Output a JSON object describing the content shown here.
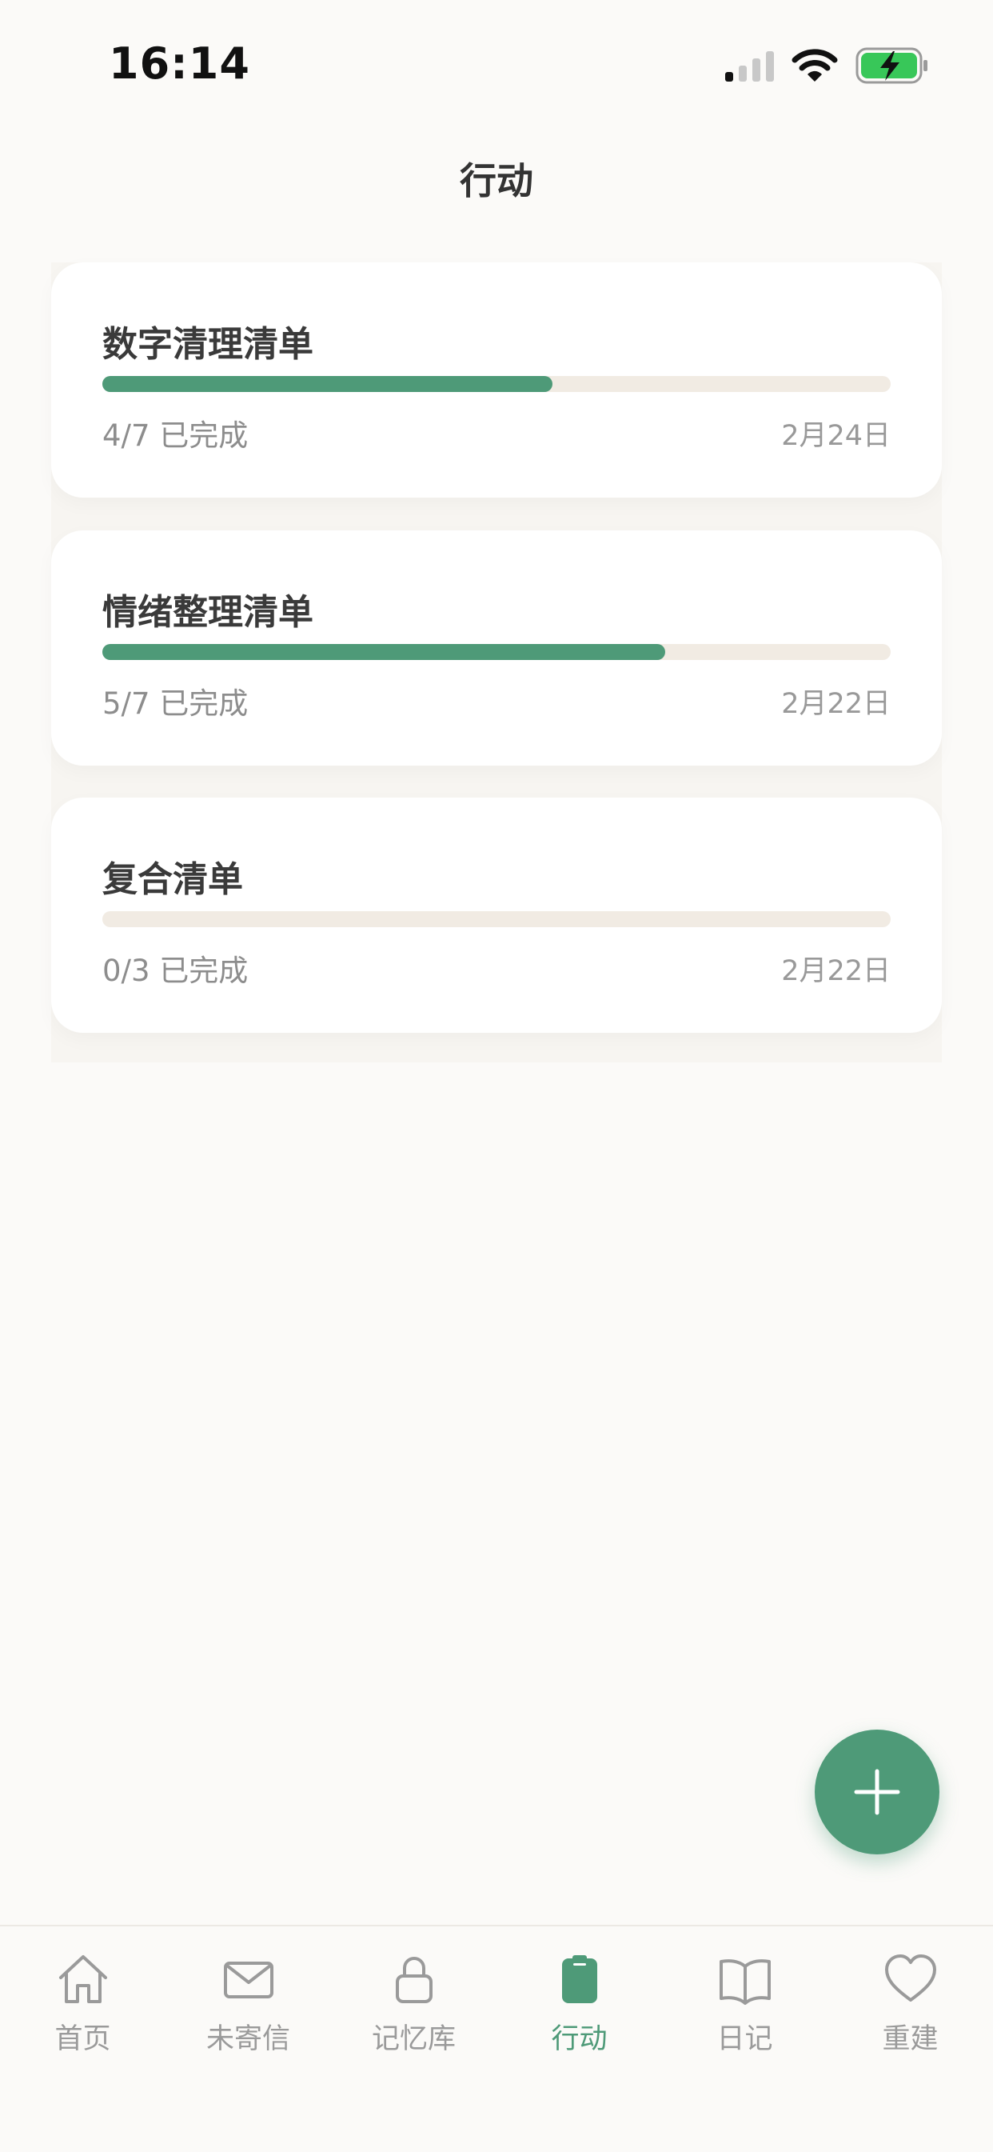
{
  "status_bar": {
    "time": "16:14"
  },
  "header": {
    "title": "行动"
  },
  "checklists": [
    {
      "title": "数字清理清单",
      "progress_text": "4/7 已完成",
      "date": "2月24日",
      "completed": 4,
      "total": 7
    },
    {
      "title": "情绪整理清单",
      "progress_text": "5/7 已完成",
      "date": "2月22日",
      "completed": 5,
      "total": 7
    },
    {
      "title": "复合清单",
      "progress_text": "0/3 已完成",
      "date": "2月22日",
      "completed": 0,
      "total": 3
    }
  ],
  "fab": {
    "icon": "plus-icon"
  },
  "tab_bar": {
    "tabs": [
      {
        "label": "首页",
        "icon": "home-icon"
      },
      {
        "label": "未寄信",
        "icon": "envelope-icon"
      },
      {
        "label": "记忆库",
        "icon": "lock-icon"
      },
      {
        "label": "行动",
        "icon": "clipboard-icon",
        "active": true
      },
      {
        "label": "日记",
        "icon": "book-icon"
      },
      {
        "label": "重建",
        "icon": "heart-icon"
      }
    ]
  },
  "colors": {
    "accent": "#4e9a78",
    "track": "#f1ebe3",
    "background": "#fbfaf8"
  }
}
